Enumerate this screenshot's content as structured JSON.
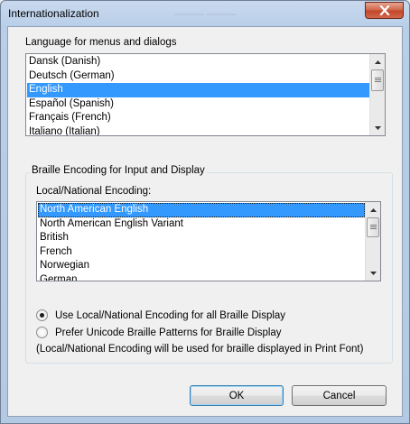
{
  "window": {
    "title": "Internationalization",
    "ghost_title": "——— ———"
  },
  "language": {
    "label": "Language for menus and dialogs",
    "items": [
      "Dansk (Danish)",
      "Deutsch (German)",
      "English",
      "Español (Spanish)",
      "Français (French)",
      "Italiano (Italian)"
    ],
    "selected": "English"
  },
  "braille": {
    "group_title": "Braille Encoding for Input and Display",
    "local_label": "Local/National Encoding:",
    "items": [
      "North American English",
      "North American English Variant",
      "British",
      "French",
      "Norwegian",
      "German"
    ],
    "selected": "North American English",
    "radio_local": "Use Local/National Encoding for all Braille Display",
    "radio_unicode": "Prefer Unicode Braille Patterns for Braille Display",
    "radio_selected": "local",
    "note": "(Local/National Encoding will be used for braille displayed in Print Font)"
  },
  "buttons": {
    "ok": "OK",
    "cancel": "Cancel"
  },
  "icons": {
    "close": "close-icon",
    "scroll_up": "chevron-up-icon",
    "scroll_down": "chevron-down-icon"
  },
  "colors": {
    "selection": "#3399ff",
    "close_button": "#c2462a"
  }
}
